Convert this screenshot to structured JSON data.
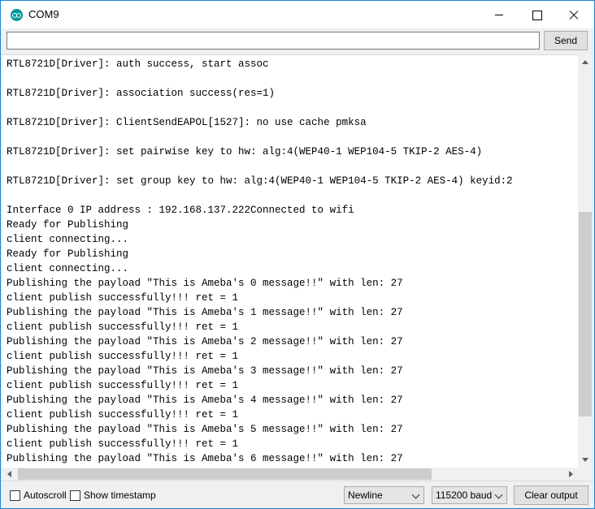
{
  "window": {
    "title": "COM9",
    "icon": "arduino-icon"
  },
  "send_row": {
    "input_value": "",
    "send_label": "Send"
  },
  "log": [
    "RTL8721D[Driver]: auth success, start assoc",
    "",
    "RTL8721D[Driver]: association success(res=1)",
    "",
    "RTL8721D[Driver]: ClientSendEAPOL[1527]: no use cache pmksa",
    "",
    "RTL8721D[Driver]: set pairwise key to hw: alg:4(WEP40-1 WEP104-5 TKIP-2 AES-4)",
    "",
    "RTL8721D[Driver]: set group key to hw: alg:4(WEP40-1 WEP104-5 TKIP-2 AES-4) keyid:2",
    "",
    "Interface 0 IP address : 192.168.137.222Connected to wifi",
    "Ready for Publishing",
    "client connecting...",
    "Ready for Publishing",
    "client connecting...",
    "Publishing the payload \"This is Ameba's 0 message!!\" with len: 27",
    "client publish successfully!!! ret = 1",
    "Publishing the payload \"This is Ameba's 1 message!!\" with len: 27",
    "client publish successfully!!! ret = 1",
    "Publishing the payload \"This is Ameba's 2 message!!\" with len: 27",
    "client publish successfully!!! ret = 1",
    "Publishing the payload \"This is Ameba's 3 message!!\" with len: 27",
    "client publish successfully!!! ret = 1",
    "Publishing the payload \"This is Ameba's 4 message!!\" with len: 27",
    "client publish successfully!!! ret = 1",
    "Publishing the payload \"This is Ameba's 5 message!!\" with len: 27",
    "client publish successfully!!! ret = 1",
    "Publishing the payload \"This is Ameba's 6 message!!\" with len: 27"
  ],
  "bottom_bar": {
    "autoscroll_label": "Autoscroll",
    "autoscroll_checked": false,
    "timestamp_label": "Show timestamp",
    "timestamp_checked": false,
    "line_ending": "Newline",
    "baud_rate": "115200 baud",
    "clear_label": "Clear output"
  },
  "colors": {
    "accent_border": "#1883d7",
    "icon_teal": "#00979c"
  }
}
